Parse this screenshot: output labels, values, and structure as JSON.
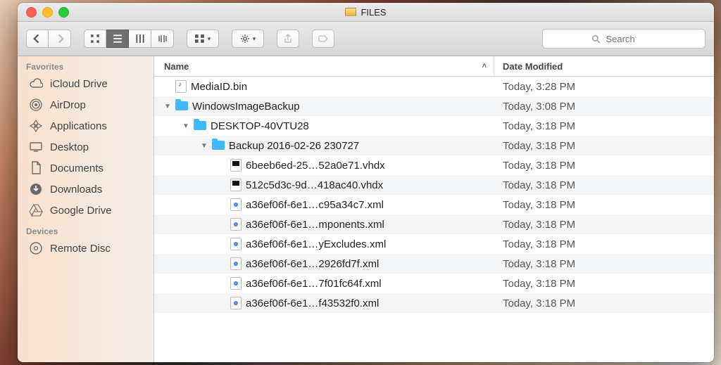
{
  "window_title": "FILES",
  "search_placeholder": "Search",
  "columns": {
    "name": "Name",
    "date": "Date Modified"
  },
  "sidebar": {
    "sections": [
      {
        "label": "Favorites",
        "items": [
          {
            "label": "iCloud Drive",
            "icon": "cloud"
          },
          {
            "label": "AirDrop",
            "icon": "airdrop"
          },
          {
            "label": "Applications",
            "icon": "apps"
          },
          {
            "label": "Desktop",
            "icon": "desktop"
          },
          {
            "label": "Documents",
            "icon": "documents"
          },
          {
            "label": "Downloads",
            "icon": "downloads"
          },
          {
            "label": "Google Drive",
            "icon": "gdrive"
          }
        ]
      },
      {
        "label": "Devices",
        "items": [
          {
            "label": "Remote Disc",
            "icon": "disc"
          }
        ]
      }
    ]
  },
  "files": [
    {
      "indent": 0,
      "disclosure": "",
      "icon": "bin",
      "name": "MediaID.bin",
      "date": "Today, 3:28 PM"
    },
    {
      "indent": 0,
      "disclosure": "▼",
      "icon": "folder",
      "name": "WindowsImageBackup",
      "date": "Today, 3:08 PM"
    },
    {
      "indent": 1,
      "disclosure": "▼",
      "icon": "folder",
      "name": "DESKTOP-40VTU28",
      "date": "Today, 3:18 PM"
    },
    {
      "indent": 2,
      "disclosure": "▼",
      "icon": "folder",
      "name": "Backup 2016-02-26 230727",
      "date": "Today, 3:18 PM"
    },
    {
      "indent": 3,
      "disclosure": "",
      "icon": "vhdx",
      "name": "6beeb6ed-25…52a0e71.vhdx",
      "date": "Today, 3:18 PM"
    },
    {
      "indent": 3,
      "disclosure": "",
      "icon": "vhdx",
      "name": "512c5d3c-9d…418ac40.vhdx",
      "date": "Today, 3:18 PM"
    },
    {
      "indent": 3,
      "disclosure": "",
      "icon": "xml",
      "name": "a36ef06f-6e1…c95a34c7.xml",
      "date": "Today, 3:18 PM"
    },
    {
      "indent": 3,
      "disclosure": "",
      "icon": "xml",
      "name": "a36ef06f-6e1…mponents.xml",
      "date": "Today, 3:18 PM"
    },
    {
      "indent": 3,
      "disclosure": "",
      "icon": "xml",
      "name": "a36ef06f-6e1…yExcludes.xml",
      "date": "Today, 3:18 PM"
    },
    {
      "indent": 3,
      "disclosure": "",
      "icon": "xml",
      "name": "a36ef06f-6e1…2926fd7f.xml",
      "date": "Today, 3:18 PM"
    },
    {
      "indent": 3,
      "disclosure": "",
      "icon": "xml",
      "name": "a36ef06f-6e1…7f01fc64f.xml",
      "date": "Today, 3:18 PM"
    },
    {
      "indent": 3,
      "disclosure": "",
      "icon": "xml",
      "name": "a36ef06f-6e1…f43532f0.xml",
      "date": "Today, 3:18 PM"
    }
  ]
}
